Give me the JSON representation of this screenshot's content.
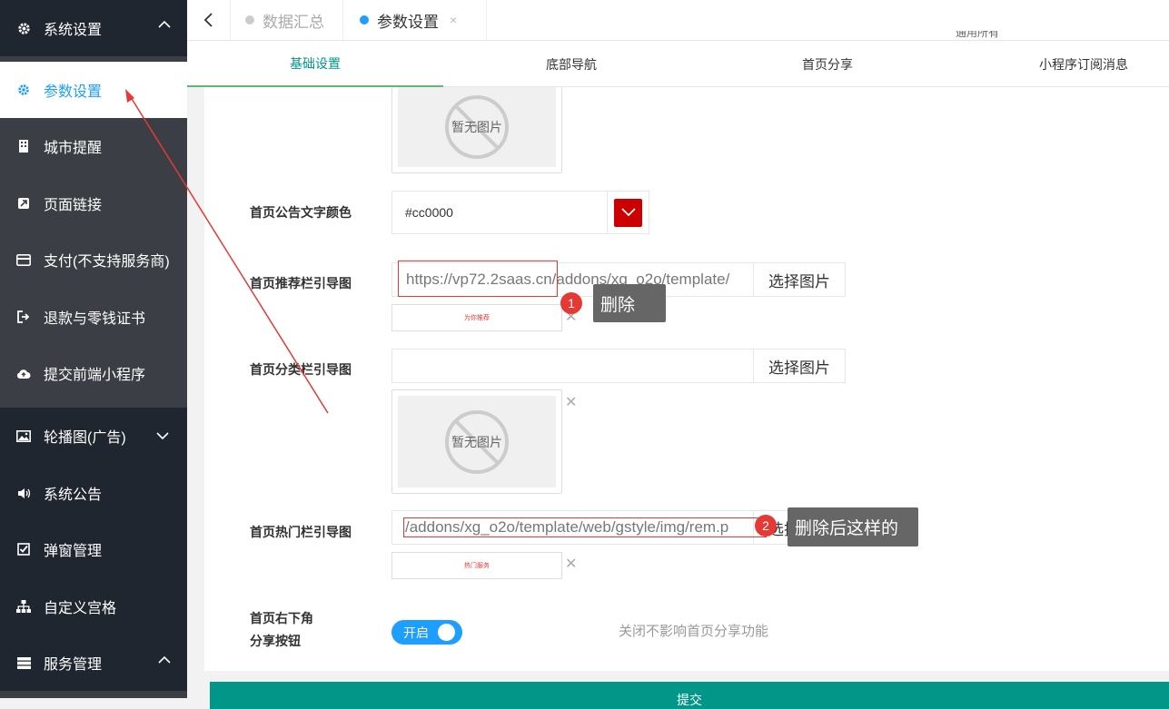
{
  "sidebar": {
    "header": {
      "label": "系统设置",
      "icon": "gear-icon"
    },
    "items": [
      {
        "label": "参数设置",
        "icon": "gear-icon",
        "active": true
      },
      {
        "label": "城市提醒",
        "icon": "building-icon"
      },
      {
        "label": "页面链接",
        "icon": "external-link-icon"
      },
      {
        "label": "支付(不支持服务商)",
        "icon": "card-icon"
      },
      {
        "label": "退款与零钱证书",
        "icon": "sign-out-icon"
      },
      {
        "label": "提交前端小程序",
        "icon": "cloud-upload-icon"
      },
      {
        "label": "轮播图(广告)",
        "icon": "image-icon"
      },
      {
        "label": "系统公告",
        "icon": "volume-icon"
      },
      {
        "label": "弹窗管理",
        "icon": "check-square-icon"
      },
      {
        "label": "自定义宫格",
        "icon": "sitemap-icon"
      },
      {
        "label": "服务管理",
        "icon": "server-icon"
      }
    ]
  },
  "topbar": {
    "tabs": [
      {
        "label": "数据汇总"
      },
      {
        "label": "参数设置",
        "close": "×"
      }
    ],
    "cut_text": "通用所有"
  },
  "subnav": {
    "items": [
      "基础设置",
      "底部导航",
      "首页分享",
      "小程序订阅消息"
    ]
  },
  "form": {
    "placeholder_image_text": "暂无图片",
    "notice_color": {
      "label": "首页公告文字颜色",
      "value": "#cc0000",
      "swatch": "#cc0000"
    },
    "recommend": {
      "label": "首页推荐栏引导图",
      "value": "https://vp72.2saas.cn/addons/xg_o2o/template/",
      "button": "选择图片",
      "thumb_text": "为你推荐"
    },
    "category": {
      "label": "首页分类栏引导图",
      "value": "",
      "button": "选择图片"
    },
    "hot": {
      "label": "首页热门栏引导图",
      "value": "/addons/xg_o2o/template/web/gstyle/img/rem.p",
      "button": "选择图片",
      "thumb_text": "热门服务"
    },
    "share": {
      "label_line1": "首页右下角",
      "label_line2": "分享按钮",
      "switch_label": "开启",
      "hint": "关闭不影响首页分享功能"
    },
    "submit_label": "提交"
  },
  "annotations": {
    "step1": {
      "number": "1",
      "text": "删除"
    },
    "step2": {
      "number": "2",
      "text": "删除后这样的"
    }
  },
  "colors": {
    "accent": "#1e9fff",
    "green": "#009688",
    "annotation_red": "#e53935"
  }
}
